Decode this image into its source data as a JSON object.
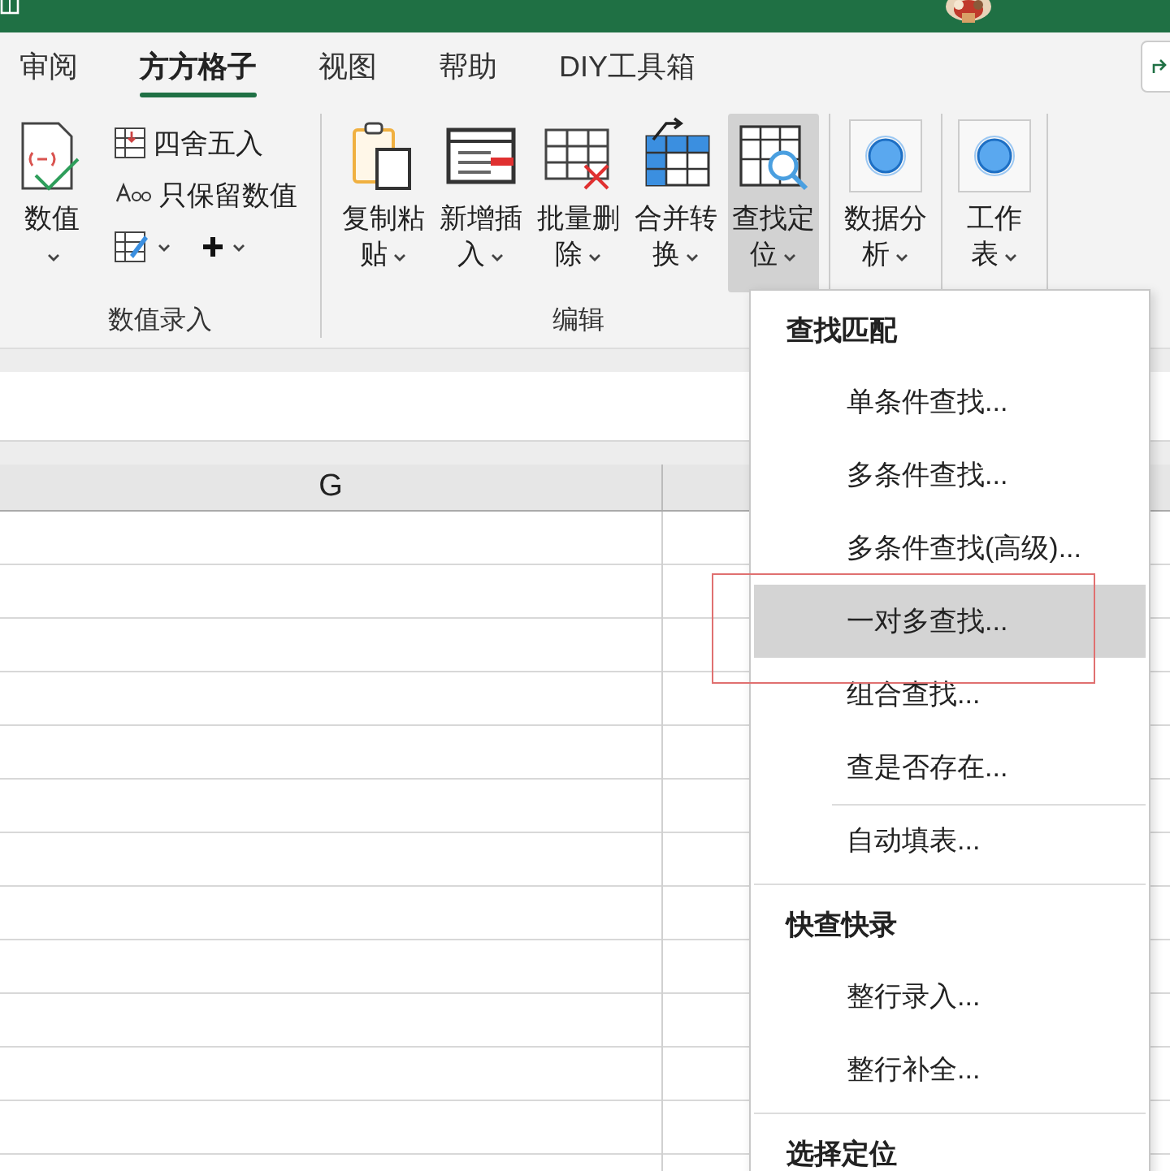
{
  "tabs": [
    {
      "label": "审阅",
      "selected": false
    },
    {
      "label": "方方格子",
      "selected": true
    },
    {
      "label": "视图",
      "selected": false
    },
    {
      "label": "帮助",
      "selected": false
    },
    {
      "label": "DIY工具箱",
      "selected": false
    }
  ],
  "ribbon": {
    "groups": [
      {
        "label": "数值录入",
        "large": [
          {
            "label": "数值",
            "selected": false
          }
        ],
        "small": [
          {
            "label": "四舍五入"
          },
          {
            "label": "只保留数值"
          }
        ]
      },
      {
        "label": "编辑",
        "large": [
          {
            "label": "复制粘贴",
            "selected": false
          },
          {
            "label": "新增插入",
            "selected": false
          },
          {
            "label": "批量删除",
            "selected": false
          },
          {
            "label": "合并转换",
            "selected": false
          },
          {
            "label": "查找定位",
            "selected": true
          }
        ]
      },
      {
        "large": [
          {
            "label": "数据分析",
            "selected": false
          }
        ]
      },
      {
        "large": [
          {
            "label": "工作表",
            "selected": false
          }
        ]
      }
    ]
  },
  "sheet": {
    "columns": [
      "G"
    ]
  },
  "menu": {
    "sections": [
      {
        "header": "查找匹配",
        "items": [
          {
            "label": "单条件查找...",
            "selected": false,
            "divider_above": false
          },
          {
            "label": "多条件查找...",
            "selected": false,
            "divider_above": false
          },
          {
            "label": "多条件查找(高级)...",
            "selected": false,
            "divider_above": false
          },
          {
            "label": "一对多查找...",
            "selected": true,
            "divider_above": false
          },
          {
            "label": "组合查找...",
            "selected": false,
            "divider_above": false
          },
          {
            "label": "查是否存在...",
            "selected": false,
            "divider_above": false
          },
          {
            "label": "自动填表...",
            "selected": false,
            "divider_above": true
          }
        ]
      },
      {
        "header": "快查快录",
        "items": [
          {
            "label": "整行录入...",
            "selected": false,
            "divider_above": false
          },
          {
            "label": "整行补全...",
            "selected": false,
            "divider_above": false
          }
        ]
      },
      {
        "header": "选择定位"
      }
    ]
  }
}
